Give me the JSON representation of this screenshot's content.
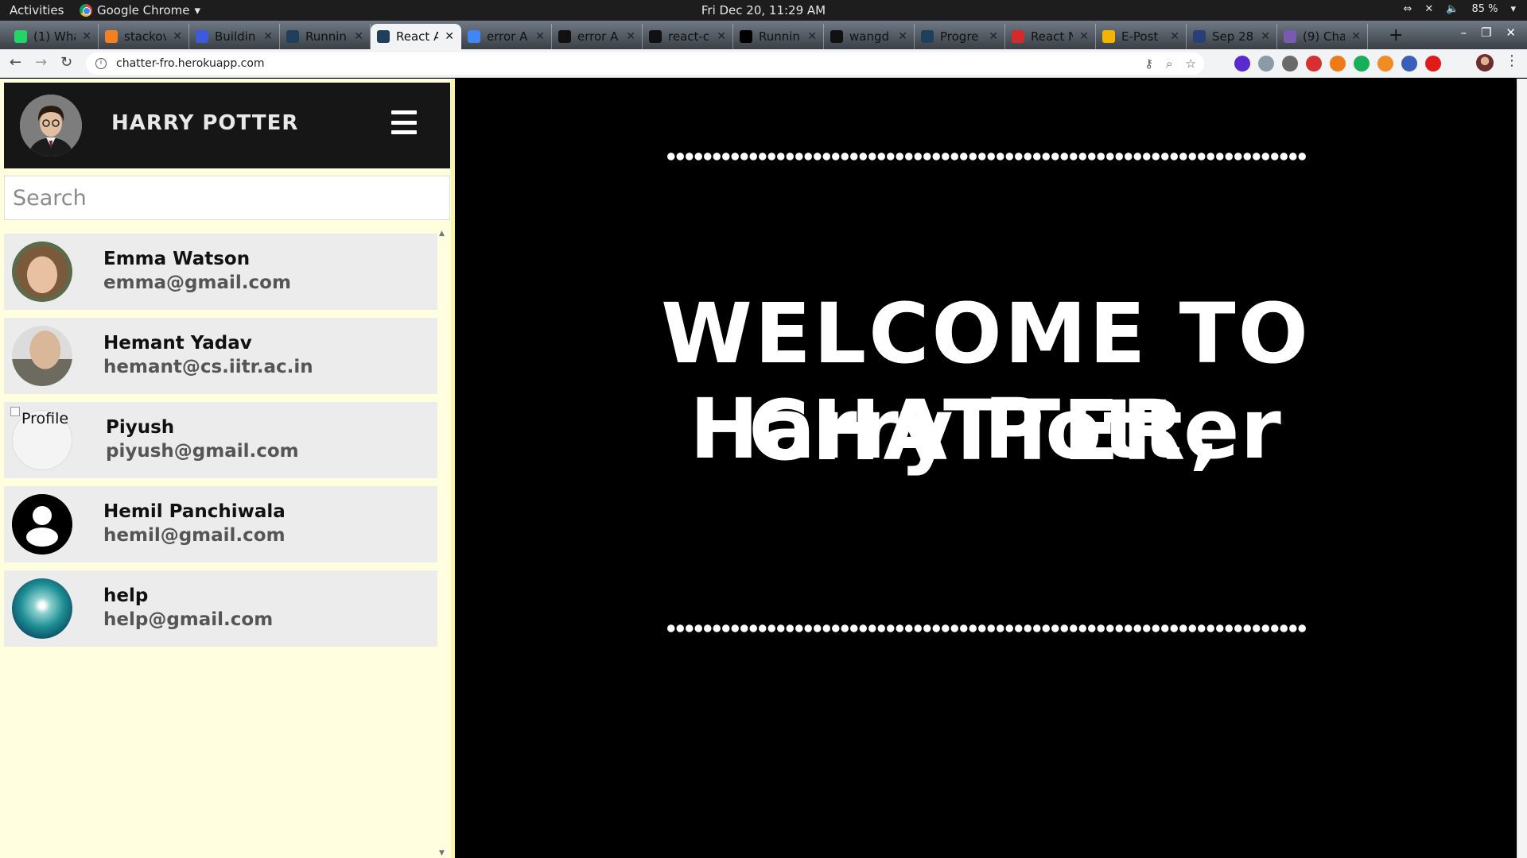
{
  "os": {
    "activities": "Activities",
    "app_name": "Google Chrome",
    "clock": "Fri Dec 20, 11:29 AM",
    "battery": "85 %"
  },
  "browser": {
    "tabs": [
      {
        "title": "(1) Wha",
        "icon": "whatsapp-icon",
        "color": "#25d366"
      },
      {
        "title": "stackov",
        "icon": "stackoverflow-icon",
        "color": "#f48024"
      },
      {
        "title": "Buildin",
        "icon": "codesandbox-icon",
        "color": "#3b5bdb"
      },
      {
        "title": "Runnin",
        "icon": "react-icon",
        "color": "#1f3f5a"
      },
      {
        "title": "React A",
        "icon": "react-icon",
        "color": "#1f3f5a"
      },
      {
        "title": "error A",
        "icon": "google-icon",
        "color": "#4285f4"
      },
      {
        "title": "error A",
        "icon": "github-icon",
        "color": "#111111"
      },
      {
        "title": "react-c",
        "icon": "github-icon",
        "color": "#111111"
      },
      {
        "title": "Runnin",
        "icon": "medium-icon",
        "color": "#000000"
      },
      {
        "title": "wangd",
        "icon": "github-icon",
        "color": "#111111"
      },
      {
        "title": "Progre",
        "icon": "react-icon",
        "color": "#1f3f5a"
      },
      {
        "title": "React N",
        "icon": "vivaldi-icon",
        "color": "#d22b2b"
      },
      {
        "title": "E-Post",
        "icon": "slides-icon",
        "color": "#f4b400"
      },
      {
        "title": "Sep 28",
        "icon": "expand-icon",
        "color": "#2b3f77"
      },
      {
        "title": "(9) Cha",
        "icon": "chat-icon",
        "color": "#7a5ab0"
      }
    ],
    "active_tab_index": 4,
    "url": "chatter-fro.herokuapp.com"
  },
  "sidebar": {
    "user_name": "HARRY POTTER",
    "search_placeholder": "Search",
    "contacts": [
      {
        "name": "Emma Watson",
        "email": "emma@gmail.com",
        "avatar": "photo"
      },
      {
        "name": "Hemant Yadav",
        "email": "hemant@cs.iitr.ac.in",
        "avatar": "photo"
      },
      {
        "name": "Piyush",
        "email": "piyush@gmail.com",
        "avatar": "broken-image",
        "avatar_alt": "Profile"
      },
      {
        "name": "Hemil Panchiwala",
        "email": "hemil@gmail.com",
        "avatar": "default-user-icon"
      },
      {
        "name": "help",
        "email": "help@gmail.com",
        "avatar": "photo"
      }
    ]
  },
  "welcome": {
    "line1": "WELCOME TO CHATTER,",
    "line2": "Harry Potter"
  },
  "colors": {
    "sidebar_bg": "#ffffe0",
    "header_bg": "#161616",
    "contact_bg": "#ececec",
    "welcome_bg": "#000000"
  }
}
